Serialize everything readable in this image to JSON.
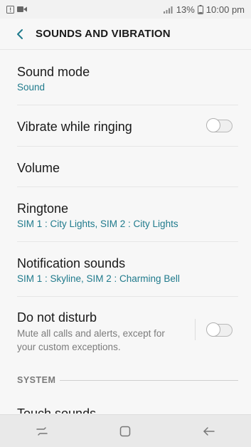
{
  "status_bar": {
    "left_icons": [
      "warning-box-icon",
      "video-icon"
    ],
    "battery_percent": "13%",
    "time": "10:00 pm"
  },
  "header": {
    "title": "SOUNDS AND VIBRATION"
  },
  "settings": {
    "sound_mode": {
      "title": "Sound mode",
      "value": "Sound"
    },
    "vibrate": {
      "title": "Vibrate while ringing",
      "enabled": false
    },
    "volume": {
      "title": "Volume"
    },
    "ringtone": {
      "title": "Ringtone",
      "value": "SIM 1 : City Lights, SIM 2 : City Lights"
    },
    "notification_sounds": {
      "title": "Notification sounds",
      "value": "SIM 1 : Skyline, SIM 2 : Charming Bell"
    },
    "do_not_disturb": {
      "title": "Do not disturb",
      "description": "Mute all calls and alerts, except for your custom exceptions.",
      "enabled": false
    },
    "system_section": "SYSTEM",
    "touch_sounds": {
      "title": "Touch sounds"
    }
  },
  "colors": {
    "accent": "#1f7a8c",
    "background": "#f7f7f7"
  },
  "nav_bar": {
    "icons": [
      "recent-apps-icon",
      "home-icon",
      "back-icon"
    ]
  }
}
